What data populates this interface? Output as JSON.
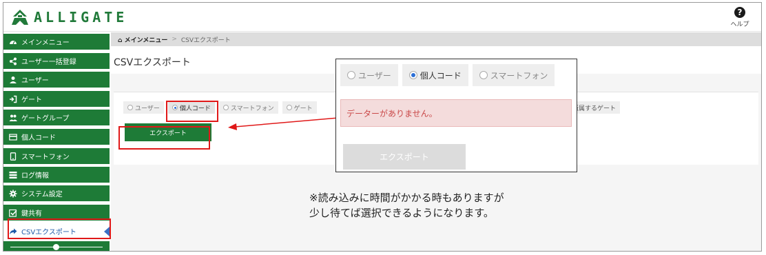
{
  "header": {
    "logo_text": "ALLIGATE",
    "help_label": "ヘルプ"
  },
  "sidebar": {
    "items": [
      {
        "label": "メインメニュー",
        "icon": "dashboard-icon"
      },
      {
        "label": "ユーザー一括登録",
        "icon": "share-icon"
      },
      {
        "label": "ユーザー",
        "icon": "user-icon"
      },
      {
        "label": "ゲート",
        "icon": "sign-in-icon"
      },
      {
        "label": "ゲートグループ",
        "icon": "users-icon"
      },
      {
        "label": "個人コード",
        "icon": "card-icon"
      },
      {
        "label": "スマートフォン",
        "icon": "phone-icon"
      },
      {
        "label": "ログ情報",
        "icon": "list-icon"
      },
      {
        "label": "システム設定",
        "icon": "gear-icon"
      },
      {
        "label": "鍵共有",
        "icon": "check-square-icon"
      },
      {
        "label": "CSVエクスポート",
        "icon": "share-arrow-icon",
        "active": true
      }
    ],
    "slider_value": 0.5
  },
  "breadcrumb": {
    "home": "メインメニュー",
    "separator": ">",
    "current": "CSVエクスポート"
  },
  "page": {
    "title": "CSVエクスポート",
    "radio_options": [
      "ユーザー",
      "個人コード",
      "スマートフォン",
      "ゲート"
    ],
    "selected_option": "個人コード",
    "last_option": "所属するゲート",
    "export_label": "エクスポート"
  },
  "popup": {
    "tabs": [
      "ユーザー",
      "個人コード",
      "スマートフォン"
    ],
    "selected_tab": "個人コード",
    "alert_text": "データーがありません。",
    "export_label": "エクスポート"
  },
  "note": {
    "line1": "※読み込みに時間がかかる時もありますが",
    "line2": "少し待てば選択できるようになります。"
  },
  "colors": {
    "brand_green": "#1e7b37",
    "highlight_red": "#e01818",
    "alert_bg": "#f4dcdc",
    "alert_text": "#c94848"
  }
}
